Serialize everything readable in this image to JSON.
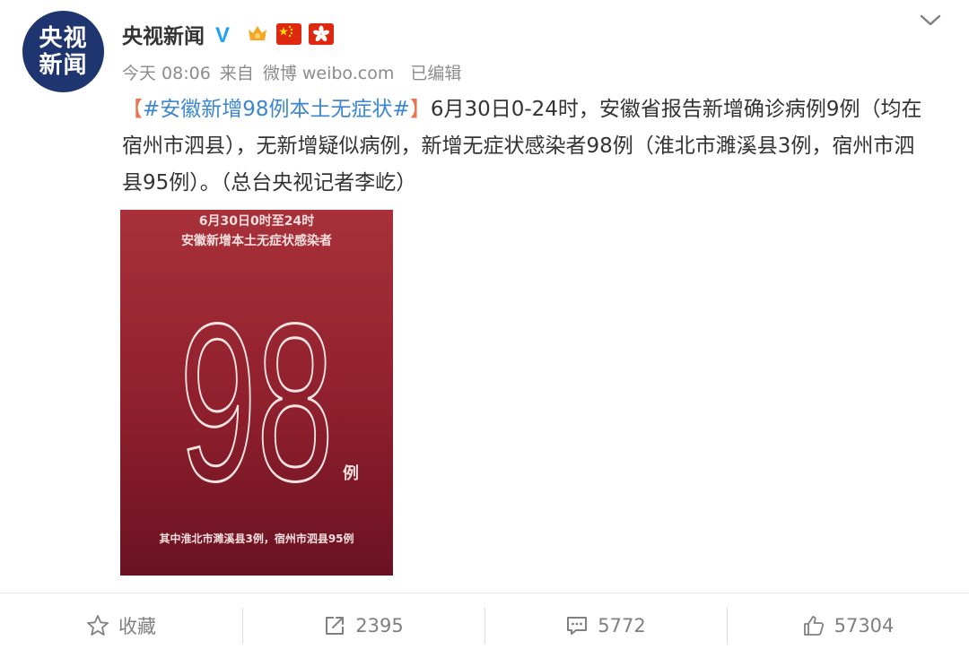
{
  "account": {
    "avatar_line1": "央视",
    "avatar_line2": "新闻",
    "name": "央视新闻",
    "verified_badge": "V",
    "colors": {
      "avatar_bg": "#1f3570",
      "verified": "#1da1f2"
    }
  },
  "meta": {
    "time": "今天 08:06",
    "from": "来自",
    "source": "微博 weibo.com",
    "edited": "已编辑"
  },
  "post": {
    "topic_open": "【",
    "topic": "#安徽新增98例本土无症状#",
    "topic_close": "】",
    "text": "6月30日0-24时，安徽省报告新增确诊病例9例（均在宿州市泗县），无新增疑似病例，新增无症状感染者98例（淮北市濉溪县3例，宿州市泗县95例）。（总台央视记者李屹）"
  },
  "image": {
    "line1": "6月30日0时至24时",
    "line2": "安徽新增本土无症状感染者",
    "big_number": "98",
    "unit": "例",
    "footer": "其中淮北市濉溪县3例，宿州市泗县95例"
  },
  "toolbar": {
    "favorite_label": "收藏",
    "repost_count": "2395",
    "comment_count": "5772",
    "like_count": "57304"
  },
  "icons": [
    "chevron-down-icon",
    "star-icon",
    "repost-icon",
    "comment-icon",
    "like-icon"
  ]
}
